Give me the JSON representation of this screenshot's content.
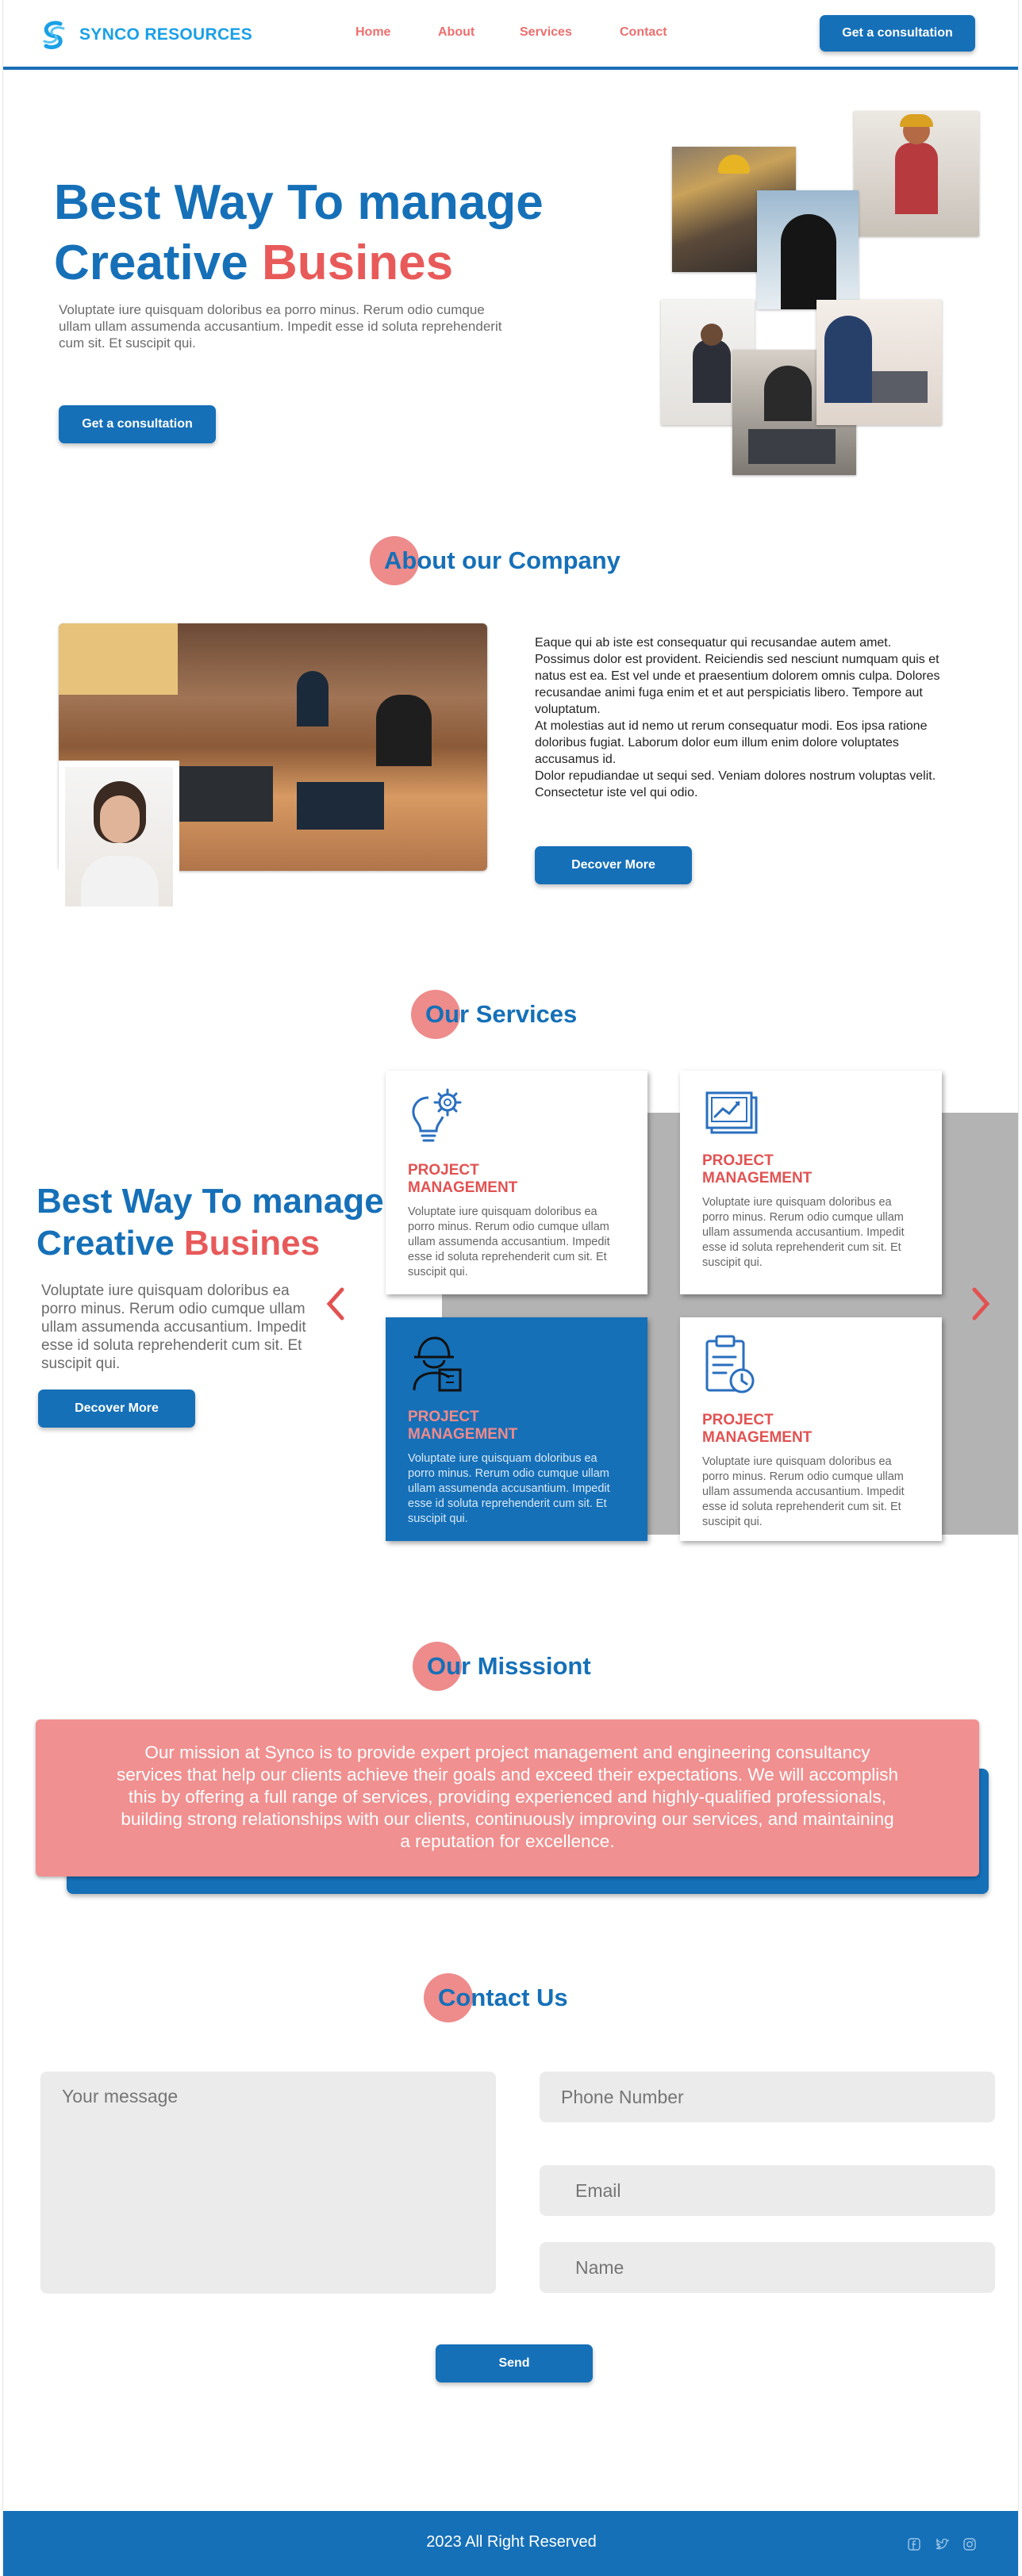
{
  "brand": {
    "name": "SYNCO RESOURCES",
    "primary": "#1570b8",
    "accent": "#e85a5a",
    "pink": "#ee8b8b"
  },
  "nav": {
    "items": [
      "Home",
      "About",
      "Services",
      "Contact"
    ],
    "cta": "Get a consultation"
  },
  "hero": {
    "title_line1": "Best Way To manage",
    "title_line2_a": "Creative ",
    "title_line2_b": "Busines",
    "text": "Voluptate iure quisquam doloribus ea porro minus. Rerum odio cumque ullam ullam assumenda accusantium. Impedit esse id soluta reprehenderit cum sit. Et suscipit qui.",
    "cta": "Get a consultation"
  },
  "about": {
    "title": "About our Company",
    "text": "Eaque qui ab iste est consequatur qui recusandae autem amet. Possimus dolor est provident. Reiciendis sed nesciunt numquam quis et natus est ea. Est vel unde et praesentium dolorem omnis culpa. Dolores recusandae animi fuga enim et et aut perspiciatis libero. Tempore aut voluptatum.\n  At molestias aut id nemo ut rerum consequatur modi. Eos ipsa ratione doloribus fugiat. Laborum dolor eum illum enim dolore voluptates accusamus id.\n  Dolor repudiandae ut sequi sed. Veniam dolores nostrum voluptas velit. Consectetur iste vel qui odio.",
    "cta": "Decover More"
  },
  "services": {
    "title": "Our Services",
    "heading_line1": "Best Way To manage",
    "heading_line2_a": "Creative ",
    "heading_line2_b": "Busines",
    "text": "Voluptate iure quisquam doloribus ea porro minus. Rerum odio cumque ullam ullam assumenda accusantium. Impedit esse id soluta reprehenderit cum sit. Et suscipit qui.",
    "cta": "Decover More",
    "cards": [
      {
        "icon": "lightbulb-gear-icon",
        "title": "PROJECT MANAGEMENT",
        "text": "Voluptate iure quisquam doloribus ea porro minus. Rerum odio cumque ullam ullam assumenda accusantium. Impedit esse id soluta reprehenderit cum sit. Et suscipit qui."
      },
      {
        "icon": "documents-chart-icon",
        "title": "PROJECT MANAGEMENT",
        "text": "Voluptate iure quisquam doloribus ea porro minus. Rerum odio cumque ullam ullam assumenda accusantium. Impedit esse id soluta reprehenderit cum sit. Et suscipit qui."
      },
      {
        "icon": "engineer-icon",
        "title": "PROJECT MANAGEMENT",
        "text": "Voluptate iure quisquam doloribus ea porro minus. Rerum odio cumque ullam ullam assumenda accusantium. Impedit esse id soluta reprehenderit cum sit. Et suscipit qui."
      },
      {
        "icon": "clipboard-clock-icon",
        "title": "PROJECT MANAGEMENT",
        "text": "Voluptate iure quisquam doloribus ea porro minus. Rerum odio cumque ullam ullam assumenda accusantium. Impedit esse id soluta reprehenderit cum sit. Et suscipit qui."
      }
    ]
  },
  "mission": {
    "title": "Our Misssiont",
    "text": "Our mission at Synco is to provide expert project management and engineering consultancy services that help our clients achieve their goals and exceed their expectations. We will accomplish this by offering a full range of services, providing experienced and highly-qualified professionals, building strong relationships with our clients, continuously improving our services, and maintaining a reputation for excellence."
  },
  "contact": {
    "title": "Contact Us",
    "message_placeholder": "Your message",
    "phone_placeholder": "Phone Number",
    "email_placeholder": "Email",
    "name_placeholder": "Name",
    "send": "Send"
  },
  "footer": {
    "copyright": "2023 All Right Reserved",
    "social": [
      "facebook-icon",
      "twitter-icon",
      "instagram-icon"
    ]
  }
}
